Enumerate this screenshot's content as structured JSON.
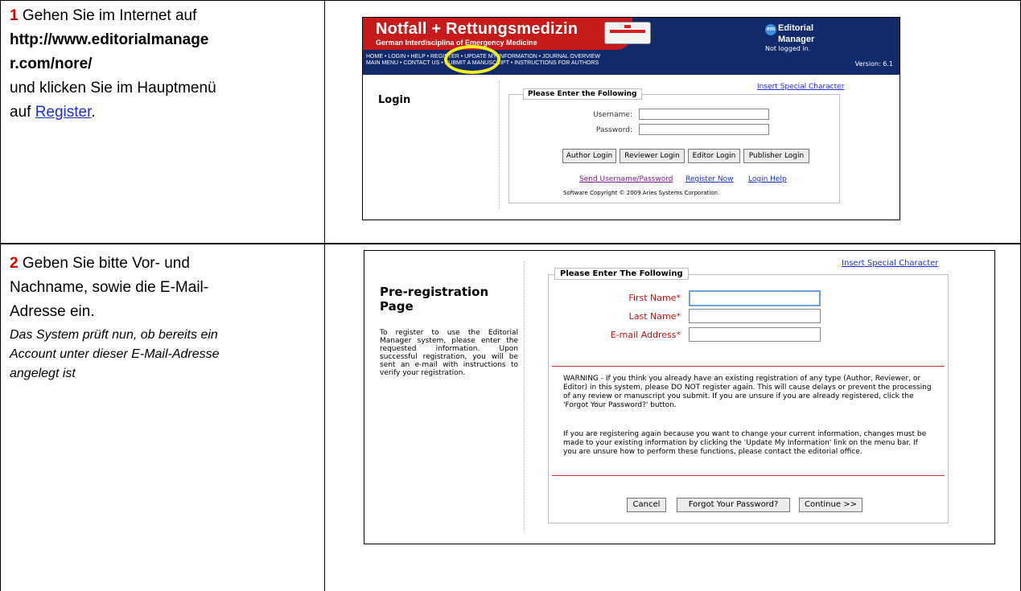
{
  "step1": {
    "number": "1",
    "line1": "Gehen Sie im Internet auf",
    "url_line1": "http://www.editorialmanage",
    "url_line2": "r.com/nore/",
    "line3": "und klicken Sie im Hauptmenü",
    "line4_prefix": "auf ",
    "link": "Register",
    "line4_suffix": "."
  },
  "step2": {
    "number": "2",
    "line1": "Geben Sie bitte Vor- und",
    "line2": "Nachname, sowie die E-Mail-",
    "line3": "Adresse ein.",
    "note1": "Das System prüft nun, ob bereits ein",
    "note2": "Account unter dieser E-Mail-Adresse",
    "note3": "angelegt ist"
  },
  "login_screen": {
    "journal_title": "Notfall + Rettungsmedizin",
    "journal_subtitle": "German Interdisciplina          of Emergency Medicine",
    "logo_line1": "Editorial",
    "logo_line2": "Manager",
    "logo_badge": "em",
    "not_logged_in": "Not logged in.",
    "version": "Version: 6.1",
    "menu_line1": "HOME  •  LOGIN  •  HELP  •  REGISTER  •  UPDATE MY INFORMATION  •  JOURNAL OVERVIEW",
    "menu_line2": "MAIN MENU  •  CONTACT US  •  SUBMIT A MANUSCRIPT  •  INSTRUCTIONS FOR AUTHORS",
    "page_label": "Login",
    "insert_special": "Insert Special Character",
    "legend": "Please Enter the Following",
    "username_label": "Username:",
    "password_label": "Password:",
    "buttons": [
      "Author Login",
      "Reviewer Login",
      "Editor Login",
      "Publisher Login"
    ],
    "link_send": "Send Username/Password",
    "link_register": "Register Now",
    "link_help": "Login Help",
    "copyright": "Software Copyright © 2009 Aries Systems Corporation."
  },
  "prereg_screen": {
    "title_line1": "Pre-registration",
    "title_line2": "Page",
    "description": "To register to use the Editorial Manager system, please enter the requested information. Upon successful registration, you will be sent an e-mail with instructions to verify your registration.",
    "insert_special": "Insert Special Character",
    "legend": "Please Enter The Following",
    "first_name_label": "First Name*",
    "last_name_label": "Last Name*",
    "email_label": "E-mail Address*",
    "warning": "WARNING - If you think you already have an existing registration of any type (Author, Reviewer, or Editor) in this system, please DO NOT register again. This will cause delays or prevent the processing of any review or manuscript you submit. If you are unsure if you are already registered, click the 'Forgot Your Password?' button.",
    "info": "If you are registering again because you want to change your current information, changes must be made to your existing information by clicking the 'Update My Information' link on the menu bar. If you are unsure how to perform these functions, please contact the editorial office.",
    "btn_cancel": "Cancel",
    "btn_forgot": "Forgot Your Password?",
    "btn_continue": "Continue >>"
  },
  "colors": {
    "step_number": "#e00000",
    "link": "#1a2fd6",
    "header_blue": "#102a6b",
    "header_red": "#c71a1a",
    "highlight": "#f2ee1c",
    "required_label": "#c41010"
  }
}
